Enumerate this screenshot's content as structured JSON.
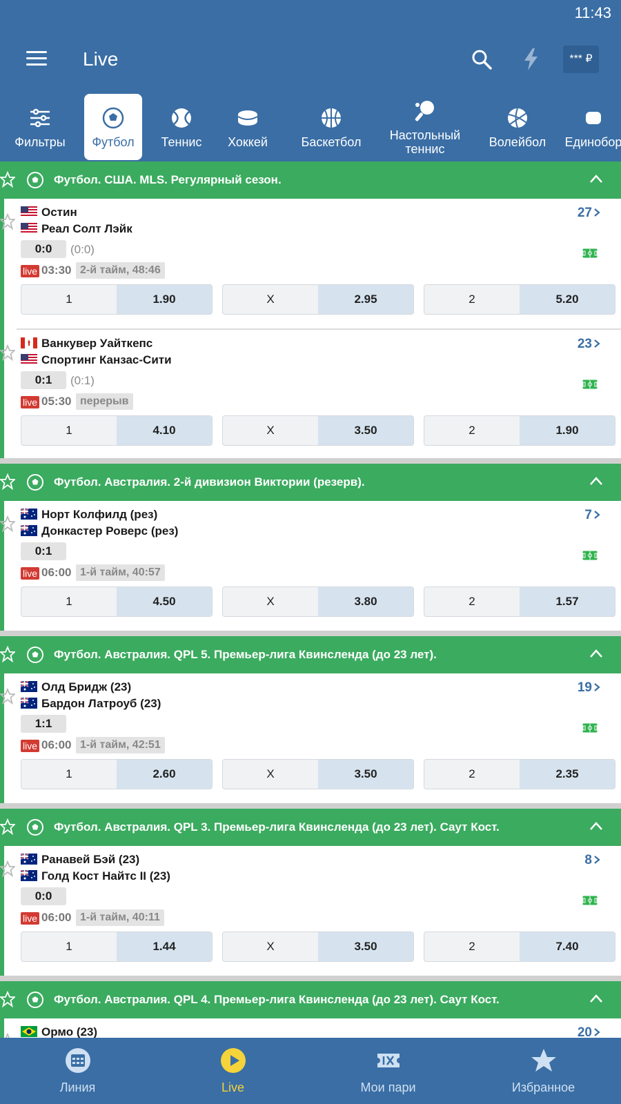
{
  "status": {
    "time": "11:43"
  },
  "header": {
    "title": "Live",
    "balance": "*** ₽"
  },
  "sports": [
    {
      "label": "Фильтры",
      "icon": "filters-icon"
    },
    {
      "label": "Футбол",
      "icon": "football-icon",
      "active": true
    },
    {
      "label": "Теннис",
      "icon": "tennis-icon"
    },
    {
      "label": "Хоккей",
      "icon": "hockey-icon"
    },
    {
      "label": "Баскетбол",
      "icon": "basketball-icon"
    },
    {
      "label": "Настольный теннис",
      "icon": "table-tennis-icon"
    },
    {
      "label": "Волейбол",
      "icon": "volleyball-icon"
    },
    {
      "label": "Единобор",
      "icon": "martial-arts-icon"
    }
  ],
  "sections": [
    {
      "title": "Футбол. США. MLS. Регулярный сезон.",
      "matches": [
        {
          "team1": "Остин",
          "flag1": "us",
          "team2": "Реал Солт Лэйк",
          "flag2": "us",
          "score": "0:0",
          "half": "(0:0)",
          "time": "03:30",
          "period": "2-й тайм, 48:46",
          "count": "27",
          "odds": [
            {
              "k": "1",
              "v": "1.90"
            },
            {
              "k": "X",
              "v": "2.95"
            },
            {
              "k": "2",
              "v": "5.20"
            }
          ]
        },
        {
          "team1": "Ванкувер Уайткепс",
          "flag1": "ca",
          "team2": "Спортинг Канзас-Сити",
          "flag2": "us",
          "score": "0:1",
          "half": "(0:1)",
          "time": "05:30",
          "period": "перерыв",
          "count": "23",
          "odds": [
            {
              "k": "1",
              "v": "4.10"
            },
            {
              "k": "X",
              "v": "3.50"
            },
            {
              "k": "2",
              "v": "1.90"
            }
          ]
        }
      ]
    },
    {
      "title": "Футбол. Австралия. 2-й дивизион Виктории (резерв).",
      "matches": [
        {
          "team1": "Норт Колфилд (рез)",
          "flag1": "au",
          "team2": "Донкастер Роверс (рез)",
          "flag2": "au",
          "score": "0:1",
          "half": "",
          "time": "06:00",
          "period": "1-й тайм, 40:57",
          "count": "7",
          "odds": [
            {
              "k": "1",
              "v": "4.50"
            },
            {
              "k": "X",
              "v": "3.80"
            },
            {
              "k": "2",
              "v": "1.57"
            }
          ]
        }
      ]
    },
    {
      "title": "Футбол. Австралия. QPL 5. Премьер-лига Квинсленда (до 23 лет).",
      "matches": [
        {
          "team1": "Олд Бридж (23)",
          "flag1": "au",
          "team2": "Бардон Латроуб (23)",
          "flag2": "au",
          "score": "1:1",
          "half": "",
          "time": "06:00",
          "period": "1-й тайм, 42:51",
          "count": "19",
          "odds": [
            {
              "k": "1",
              "v": "2.60"
            },
            {
              "k": "X",
              "v": "3.50"
            },
            {
              "k": "2",
              "v": "2.35"
            }
          ]
        }
      ]
    },
    {
      "title": "Футбол. Австралия. QPL 3. Премьер-лига Квинсленда (до 23 лет). Саут Кост.",
      "matches": [
        {
          "team1": "Ранавей Бэй (23)",
          "flag1": "au",
          "team2": "Голд Кост Найтс II (23)",
          "flag2": "au",
          "score": "0:0",
          "half": "",
          "time": "06:00",
          "period": "1-й тайм, 40:11",
          "count": "8",
          "odds": [
            {
              "k": "1",
              "v": "1.44"
            },
            {
              "k": "X",
              "v": "3.50"
            },
            {
              "k": "2",
              "v": "7.40"
            }
          ]
        }
      ]
    },
    {
      "title": "Футбол. Австралия. QPL 4. Премьер-лига Квинсленда (до 23 лет). Саут Кост.",
      "matches": [
        {
          "team1": "Ормо (23)",
          "flag1": "br",
          "team2": "",
          "flag2": "",
          "score": "",
          "half": "",
          "time": "",
          "period": "",
          "count": "20",
          "odds": []
        }
      ]
    }
  ],
  "bottom_nav": [
    {
      "label": "Линия",
      "icon": "calendar-icon"
    },
    {
      "label": "Live",
      "icon": "play-icon",
      "active": true
    },
    {
      "label": "Мои пари",
      "icon": "ticket-icon"
    },
    {
      "label": "Избранное",
      "icon": "star-icon"
    }
  ],
  "colors": {
    "primary": "#3a6ea5",
    "section": "#3bab5f",
    "live": "#d23a32",
    "active_nav": "#f5d33a"
  }
}
